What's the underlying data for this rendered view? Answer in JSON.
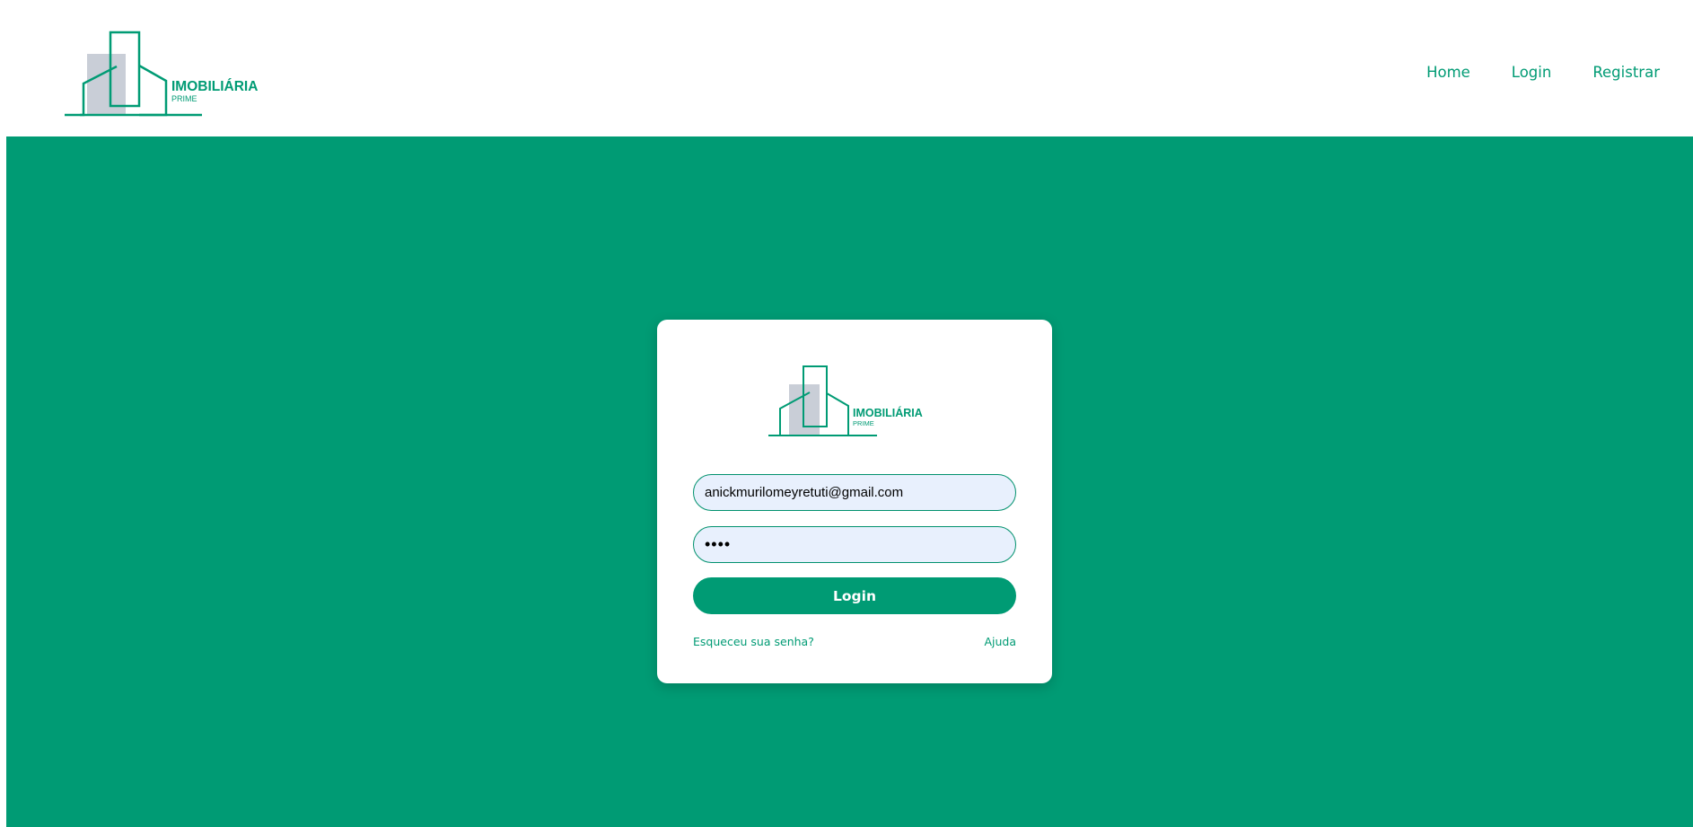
{
  "brand": {
    "name": "IMOBILIÁRIA",
    "tagline": "PRIME"
  },
  "nav": {
    "items": [
      "Home",
      "Login",
      "Registrar"
    ]
  },
  "login_form": {
    "email_value": "anickmurilomeyretuti@gmail.com",
    "password_value": "••••",
    "submit_label": "Login",
    "forgot_password_link": "Esqueceu sua senha?",
    "help_link": "Ajuda"
  },
  "colors": {
    "brand_green": "#009b74",
    "logo_gray": "#c9ced7",
    "input_fill": "#e8f0fd",
    "background_white": "#ffffff"
  }
}
